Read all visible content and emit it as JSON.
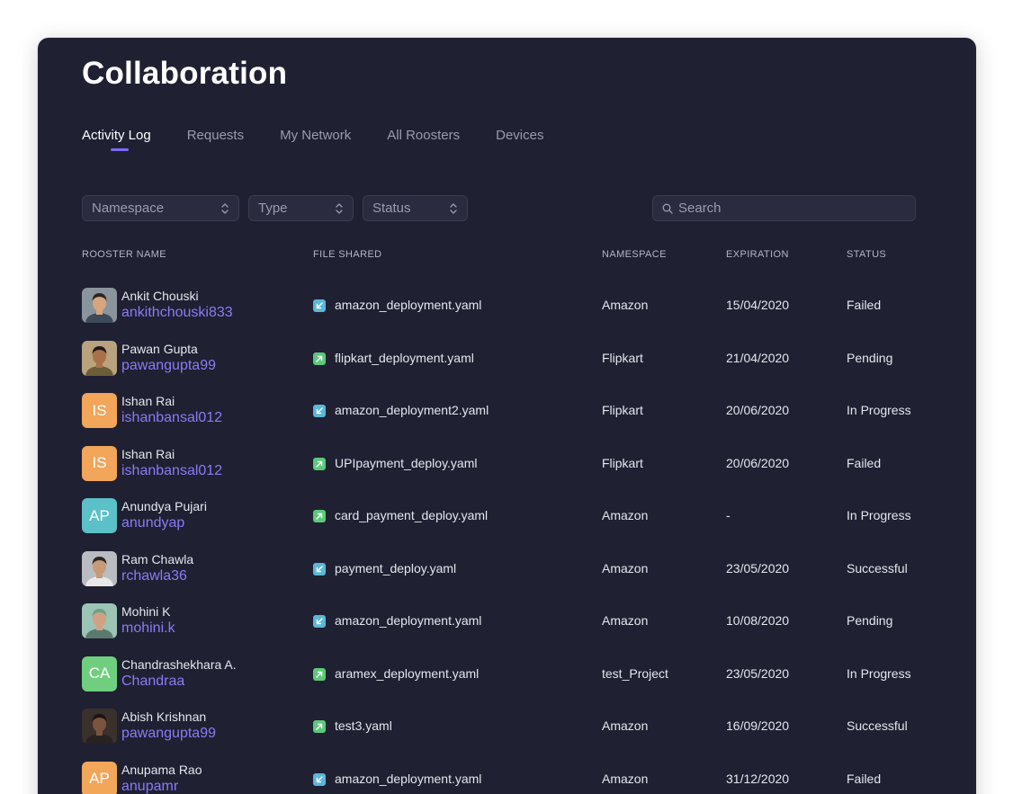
{
  "page_title": "Collaboration",
  "tabs": [
    {
      "label": "Activity Log",
      "active": true
    },
    {
      "label": "Requests",
      "active": false
    },
    {
      "label": "My Network",
      "active": false
    },
    {
      "label": "All Roosters",
      "active": false
    },
    {
      "label": "Devices",
      "active": false
    }
  ],
  "filters": {
    "namespace": "Namespace",
    "type": "Type",
    "status": "Status"
  },
  "search": {
    "placeholder": "Search"
  },
  "table": {
    "headers": {
      "rooster_name": "ROOSTER NAME",
      "file_shared": "FILE SHARED",
      "namespace": "NAMESPACE",
      "expiration": "EXPIRATION",
      "status": "STATUS"
    },
    "rows": [
      {
        "name": "Ankit Chouski",
        "username": "ankithchouski833",
        "avatar": "photo",
        "initials": "",
        "avatar_color": "#6b7a8a",
        "file_direction": "incoming",
        "file": "amazon_deployment.yaml",
        "namespace": "Amazon",
        "expiration": "15/04/2020",
        "status": "Failed"
      },
      {
        "name": "Pawan Gupta",
        "username": "pawangupta99",
        "avatar": "photo",
        "initials": "",
        "avatar_color": "#8a6a4a",
        "file_direction": "outgoing",
        "file": "flipkart_deployment.yaml",
        "namespace": "Flipkart",
        "expiration": "21/04/2020",
        "status": "Pending"
      },
      {
        "name": "Ishan Rai",
        "username": "ishanbansal012",
        "avatar": "initials",
        "initials": "IS",
        "avatar_color": "#f2a65a",
        "file_direction": "incoming",
        "file": "amazon_deployment2.yaml",
        "namespace": "Flipkart",
        "expiration": "20/06/2020",
        "status": "In Progress"
      },
      {
        "name": "Ishan Rai",
        "username": "ishanbansal012",
        "avatar": "initials",
        "initials": "IS",
        "avatar_color": "#f2a65a",
        "file_direction": "outgoing",
        "file": "UPIpayment_deploy.yaml",
        "namespace": "Flipkart",
        "expiration": "20/06/2020",
        "status": "Failed"
      },
      {
        "name": "Anundya Pujari",
        "username": "anundyap",
        "avatar": "initials",
        "initials": "AP",
        "avatar_color": "#5bc0c7",
        "file_direction": "outgoing",
        "file": "card_payment_deploy.yaml",
        "namespace": "Amazon",
        "expiration": "-",
        "status": "In Progress"
      },
      {
        "name": "Ram Chawla",
        "username": "rchawla36",
        "avatar": "photo",
        "initials": "",
        "avatar_color": "#9aa0a6",
        "file_direction": "incoming",
        "file": "payment_deploy.yaml",
        "namespace": "Amazon",
        "expiration": "23/05/2020",
        "status": "Successful"
      },
      {
        "name": "Mohini K",
        "username": "mohini.k",
        "avatar": "photo",
        "initials": "",
        "avatar_color": "#7fa89a",
        "file_direction": "incoming",
        "file": "amazon_deployment.yaml",
        "namespace": "Amazon",
        "expiration": "10/08/2020",
        "status": "Pending"
      },
      {
        "name": "Chandrashekhara A.",
        "username": "Chandraa",
        "avatar": "initials",
        "initials": "CA",
        "avatar_color": "#6fcf7f",
        "file_direction": "outgoing",
        "file": "aramex_deployment.yaml",
        "namespace": "test_Project",
        "expiration": "23/05/2020",
        "status": "In Progress"
      },
      {
        "name": "Abish Krishnan",
        "username": "pawangupta99",
        "avatar": "photo",
        "initials": "",
        "avatar_color": "#3a3030",
        "file_direction": "outgoing",
        "file": "test3.yaml",
        "namespace": "Amazon",
        "expiration": "16/09/2020",
        "status": "Successful"
      },
      {
        "name": "Anupama Rao",
        "username": "anupamr",
        "avatar": "initials",
        "initials": "AP",
        "avatar_color": "#f2a65a",
        "file_direction": "incoming",
        "file": "amazon_deployment.yaml",
        "namespace": "Amazon",
        "expiration": "31/12/2020",
        "status": "Failed"
      }
    ]
  },
  "colors": {
    "background": "#1f2032",
    "accent": "#7b6cf6",
    "username": "#8a7cf4",
    "incoming_icon": "#5bb8d6",
    "outgoing_icon": "#5cc97a"
  }
}
